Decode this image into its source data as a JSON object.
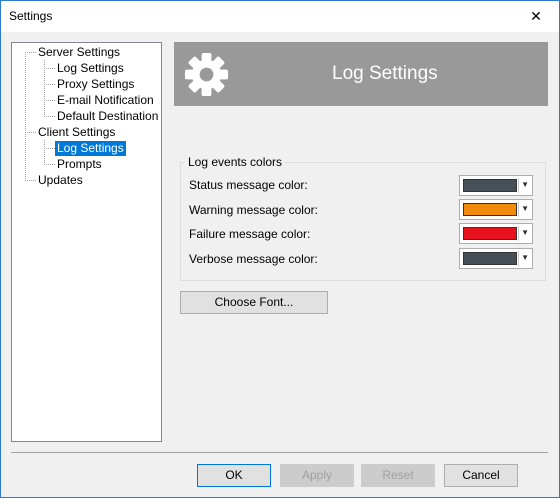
{
  "window": {
    "title": "Settings",
    "close_glyph": "✕"
  },
  "tree": {
    "items": [
      {
        "label": "Server Settings"
      },
      {
        "label": "Log Settings"
      },
      {
        "label": "Proxy Settings"
      },
      {
        "label": "E-mail Notification"
      },
      {
        "label": "Default Destination"
      },
      {
        "label": "Client Settings"
      },
      {
        "label": "Log Settings"
      },
      {
        "label": "Prompts"
      },
      {
        "label": "Updates"
      }
    ],
    "selected_index": 6
  },
  "banner": {
    "title": "Log Settings",
    "icon": "gear-icon"
  },
  "log_colors": {
    "group_label": "Log events colors",
    "rows": [
      {
        "label": "Status message color:",
        "color": "#475057"
      },
      {
        "label": "Warning message color:",
        "color": "#f28b0c"
      },
      {
        "label": "Failure message color:",
        "color": "#e8121f"
      },
      {
        "label": "Verbose message color:",
        "color": "#475057"
      }
    ]
  },
  "buttons": {
    "choose_font": "Choose Font...",
    "ok": "OK",
    "apply": "Apply",
    "reset": "Reset",
    "cancel": "Cancel"
  }
}
